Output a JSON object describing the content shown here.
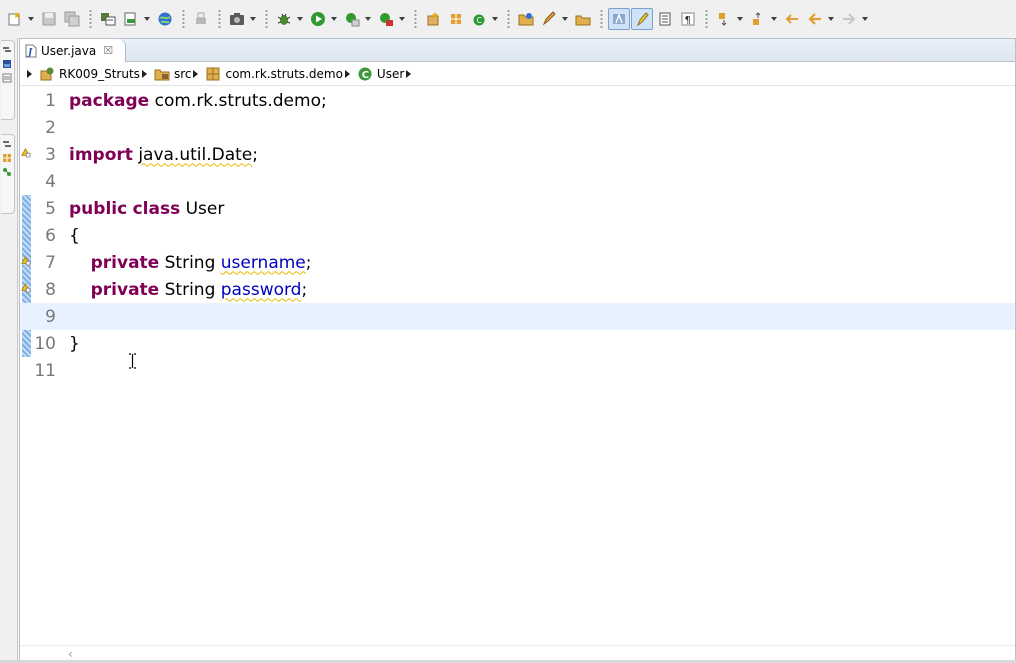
{
  "toolbar": {
    "buttons": [
      {
        "icon": "new-wizard-icon",
        "dropdown": true
      },
      {
        "icon": "save-icon",
        "dropdown": false
      },
      {
        "icon": "save-all-icon",
        "dropdown": false
      },
      {
        "sep": true
      },
      {
        "icon": "open-type-icon",
        "dropdown": false
      },
      {
        "icon": "open-task-icon",
        "dropdown": true
      },
      {
        "icon": "globe-icon",
        "dropdown": false
      },
      {
        "sep": true
      },
      {
        "icon": "print-icon",
        "dropdown": false
      },
      {
        "sep": true
      },
      {
        "icon": "camera-icon",
        "dropdown": true
      },
      {
        "sep": true
      },
      {
        "icon": "debug-icon",
        "dropdown": true
      },
      {
        "icon": "run-icon",
        "dropdown": true
      },
      {
        "icon": "coverage-icon",
        "dropdown": true
      },
      {
        "icon": "external-tools-icon",
        "dropdown": true
      },
      {
        "sep": true
      },
      {
        "icon": "new-package-icon",
        "dropdown": false
      },
      {
        "icon": "new-class-icon",
        "dropdown": false
      },
      {
        "icon": "new-refactor-icon",
        "dropdown": true
      },
      {
        "sep": true
      },
      {
        "icon": "open-folder-icon",
        "dropdown": false
      },
      {
        "icon": "pen-icon",
        "dropdown": true
      },
      {
        "icon": "search-folder-icon",
        "dropdown": false
      },
      {
        "sep": true
      },
      {
        "icon": "toggle-mark-occurrences-icon",
        "dropdown": false,
        "pressed": true
      },
      {
        "icon": "highlight-icon",
        "dropdown": false,
        "pressed": true
      },
      {
        "icon": "block-selection-icon",
        "dropdown": false
      },
      {
        "icon": "show-whitespace-icon",
        "dropdown": false
      },
      {
        "sep": true
      },
      {
        "icon": "next-annotation-icon",
        "dropdown": true
      },
      {
        "icon": "previous-annotation-icon",
        "dropdown": true
      },
      {
        "icon": "last-edit-icon",
        "dropdown": false
      },
      {
        "icon": "back-icon",
        "dropdown": true
      },
      {
        "icon": "forward-icon",
        "dropdown": true
      }
    ]
  },
  "editor": {
    "tab": {
      "label": "User.java",
      "icon": "java-file-icon",
      "close_icon": "close-icon",
      "close_glyph": "☒"
    },
    "breadcrumb": [
      {
        "label": "RK009_Struts",
        "icon": "project-icon"
      },
      {
        "label": "src",
        "icon": "source-folder-icon"
      },
      {
        "label": "com.rk.struts.demo",
        "icon": "package-icon"
      },
      {
        "label": "User",
        "icon": "class-icon"
      }
    ],
    "lines": [
      {
        "n": "1",
        "tokens": [
          {
            "t": "package",
            "k": "kw"
          },
          {
            "t": " com.rk.struts.demo;"
          }
        ]
      },
      {
        "n": "2",
        "tokens": []
      },
      {
        "n": "3",
        "marker": "warning-icon",
        "tokens": [
          {
            "t": "import",
            "k": "kw"
          },
          {
            "t": " "
          },
          {
            "t": "java.util.Date",
            "k": "warn"
          },
          {
            "t": ";"
          }
        ]
      },
      {
        "n": "4",
        "tokens": []
      },
      {
        "n": "5",
        "tokens": [
          {
            "t": "public",
            "k": "kw"
          },
          {
            "t": " "
          },
          {
            "t": "class",
            "k": "kw"
          },
          {
            "t": " User"
          }
        ]
      },
      {
        "n": "6",
        "tokens": [
          {
            "t": "{"
          }
        ]
      },
      {
        "n": "7",
        "marker": "warning-icon",
        "tokens": [
          {
            "t": "    "
          },
          {
            "t": "private",
            "k": "kw"
          },
          {
            "t": " String "
          },
          {
            "t": "username",
            "k": "fld warn"
          },
          {
            "t": ";"
          }
        ]
      },
      {
        "n": "8",
        "marker": "warning-icon",
        "tokens": [
          {
            "t": "    "
          },
          {
            "t": "private",
            "k": "kw"
          },
          {
            "t": " String "
          },
          {
            "t": "password",
            "k": "fld warn"
          },
          {
            "t": ";"
          }
        ]
      },
      {
        "n": "9",
        "current": true,
        "tokens": []
      },
      {
        "n": "10",
        "tokens": [
          {
            "t": "}"
          }
        ]
      },
      {
        "n": "11",
        "tokens": []
      }
    ],
    "hscroll_arrow": "‹"
  },
  "colors": {
    "keyword": "#7f0055",
    "field": "#0000c0",
    "warning_underline": "#e8b800",
    "current_line": "#e8f2fe",
    "line_number": "#787878"
  }
}
